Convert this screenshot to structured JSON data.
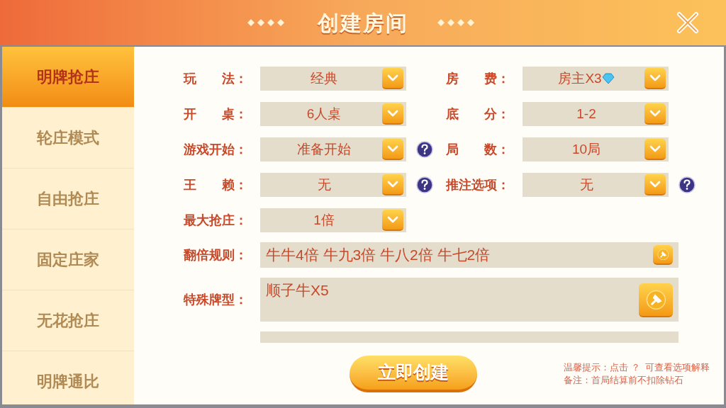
{
  "window": {
    "title": "创建房间"
  },
  "sidebar": {
    "items": [
      {
        "label": "明牌抢庄",
        "selected": true
      },
      {
        "label": "轮庄模式",
        "selected": false
      },
      {
        "label": "自由抢庄",
        "selected": false
      },
      {
        "label": "固定庄家",
        "selected": false
      },
      {
        "label": "无花抢庄",
        "selected": false
      },
      {
        "label": "明牌通比",
        "selected": false
      }
    ]
  },
  "options": [
    {
      "label": "玩　　法：",
      "value": "经典",
      "help": false,
      "diamond": false
    },
    {
      "label": "房　　费：",
      "value": "房主X3",
      "help": false,
      "diamond": true
    },
    {
      "label": "开　　桌：",
      "value": "6人桌",
      "help": false,
      "diamond": false
    },
    {
      "label": "底　　分：",
      "value": "1-2",
      "help": false,
      "diamond": false
    },
    {
      "label": "游戏开始：",
      "value": "准备开始",
      "help": true,
      "diamond": false
    },
    {
      "label": "局　　数：",
      "value": "10局",
      "help": false,
      "diamond": false
    },
    {
      "label": "王　　赖：",
      "value": "无",
      "help": true,
      "diamond": false
    },
    {
      "label": "推注选项：",
      "value": "无",
      "help": true,
      "diamond": false
    },
    {
      "label": "最大抢庄：",
      "value": "1倍",
      "help": false,
      "diamond": false
    }
  ],
  "rules": [
    {
      "label": "翻倍规则：",
      "value": "牛牛4倍 牛九3倍 牛八2倍 牛七2倍",
      "kind": "single"
    },
    {
      "label": "特殊牌型：",
      "value": "顺子牛X5",
      "kind": "tall"
    }
  ],
  "create_button": "立即创建",
  "tips": [
    "温馨提示：点击 ？  可查看选项解释",
    "备注：首局结算前不扣除钻石"
  ]
}
